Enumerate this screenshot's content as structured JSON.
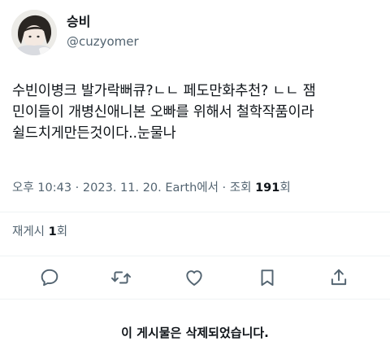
{
  "author": {
    "display_name": "승비",
    "handle": "@cuzyomer",
    "avatar_icon": "profile-avatar"
  },
  "tweet": {
    "text": "수빈이병크 발가락뻐큐?ㄴㄴ 페도만화추천? ㄴㄴ 잼\n민이들이 개병신애니본 오빠를 위해서 철학작품이라\n쉴드치게만든것이다..눈물나",
    "time": "오후 10:43",
    "sep1": " · ",
    "date": "2023. 11. 20.",
    "source": " Earth에서",
    "sep2": " · ",
    "views_label": "조회 ",
    "views_count": "191",
    "views_suffix": "회"
  },
  "retweets": {
    "label": "재게시 ",
    "count": "1",
    "suffix": "회"
  },
  "actions": [
    {
      "name": "reply",
      "icon": "reply-icon"
    },
    {
      "name": "retweet",
      "icon": "retweet-icon"
    },
    {
      "name": "like",
      "icon": "heart-icon"
    },
    {
      "name": "bookmark",
      "icon": "bookmark-icon"
    },
    {
      "name": "share",
      "icon": "share-icon"
    }
  ],
  "deleted_notice": "이 게시물은 삭제되었습니다.",
  "colors": {
    "text_primary": "#0f1419",
    "text_secondary": "#536471",
    "divider": "#eff3f4"
  }
}
